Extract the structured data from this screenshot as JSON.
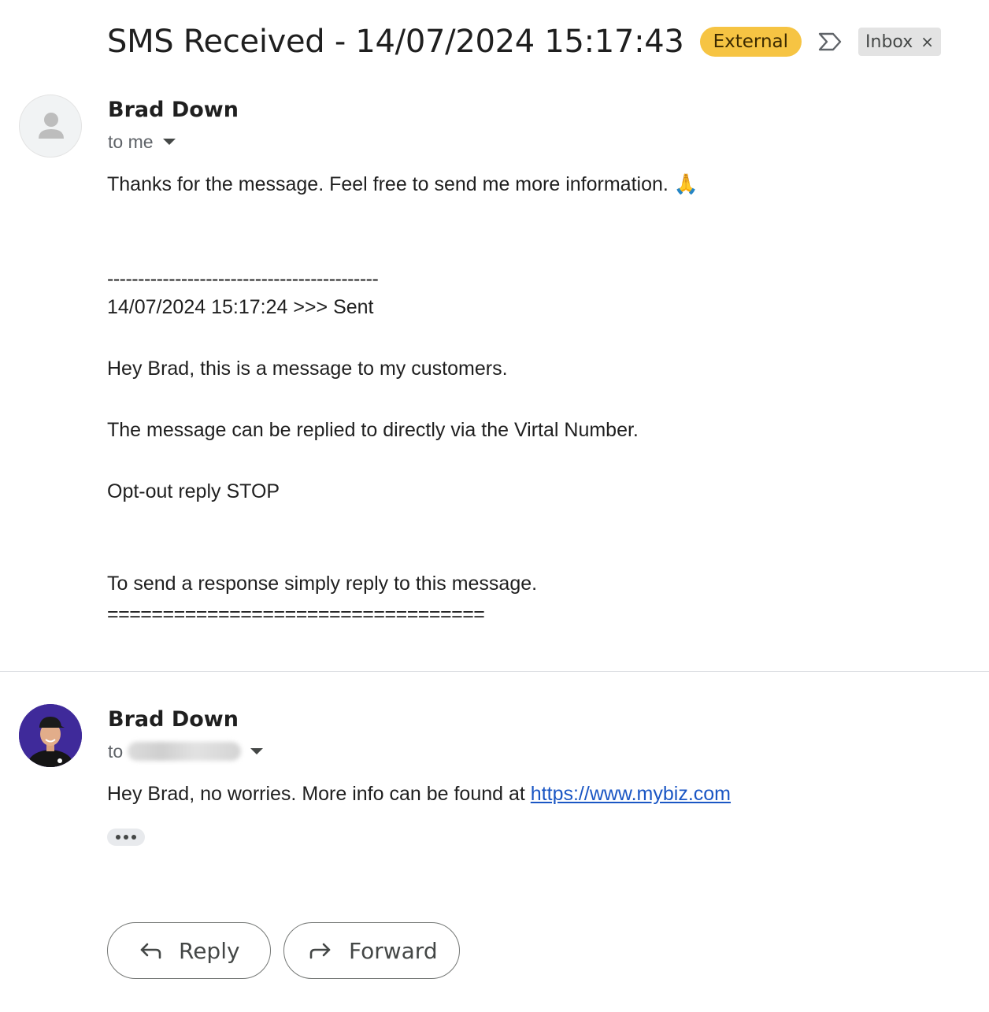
{
  "thread": {
    "subject": "SMS Received - 14/07/2024 15:17:43",
    "external_label": "External",
    "inbox_label": "Inbox",
    "remove_label_glyph": "×",
    "important_icon": "importance-marker-icon"
  },
  "message1": {
    "sender": "Brad Down",
    "to_text": "to me",
    "avatar": "default-person-icon",
    "lines": {
      "intro": "Thanks for the message. Feel free to send me more information. 🙏",
      "separator_dashes": "--------------------------------------------",
      "timestamp_sent": "14/07/2024 15:17:24 >>> Sent",
      "greeting": "Hey Brad, this is a message to my customers.",
      "reply_info": "The message can be replied to directly via the Virtal Number.",
      "opt_out": "Opt-out reply STOP",
      "instruction": "To send a response simply reply to this message.",
      "separator_equals": "=================================="
    }
  },
  "message2": {
    "sender": "Brad Down",
    "to_prefix": "to",
    "avatar": "profile-photo",
    "body_prefix": "Hey Brad, no worries. More info can be found at ",
    "link_text": "https://www.mybiz.com",
    "show_trimmed_icon": "more-horizontal-icon"
  },
  "actions": {
    "reply_label": "Reply",
    "forward_label": "Forward"
  },
  "colors": {
    "external_badge": "#f6c443",
    "inbox_chip": "#e3e3e3",
    "link": "#1a56c4",
    "avatar_bg": "#3f2a9a"
  }
}
